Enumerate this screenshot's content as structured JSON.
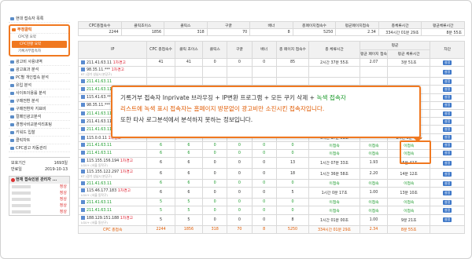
{
  "sidebar": {
    "top_item": "현대 접속자 목록",
    "group_title": "부정클릭",
    "subitems": [
      "CPC별 요약",
      "CPC현황 요약",
      "기록거부접속자"
    ],
    "items": [
      "광고비 사용내역",
      "광고효과 분석",
      "PC별 개인접속 분석",
      "유입 분석",
      "사이트이용률 분석",
      "구매전환 분석",
      "구매전환자 지표비",
      "컬페인광고분석",
      "경쟁사비교분석리포팅",
      "키워드 입찰",
      "클릭차트",
      "CPC광고 자동관리"
    ],
    "info": [
      {
        "label": "보호기간",
        "value": "1693일"
      },
      {
        "label": "만료일",
        "value": "2019-10-13"
      }
    ],
    "panel_title": "현재 접속인원 관리자 ...",
    "panel_rows": [
      "정상",
      "정상",
      "정상",
      "정상",
      "정상"
    ]
  },
  "summary": {
    "headers": [
      "CPC총접속수",
      "클릭초이스",
      "클릭스",
      "구글",
      "배너",
      "총페이지접속수",
      "평균페이지접속",
      "총체류시간",
      "평균체류시간"
    ],
    "values": [
      "2244",
      "1856",
      "318",
      "70",
      "8",
      "5250",
      "2.34",
      "334시간 01분 29초",
      "8분 55초"
    ]
  },
  "detail": {
    "headers": [
      "IP",
      "CPC 총접속수",
      "클릭 초이스",
      "클릭스",
      "구글",
      "배너",
      "총 페이지 접속수",
      "총 체류시간",
      "평균 페이지 접속",
      "평균 체류시간",
      "차단"
    ],
    "group_header": "평균",
    "block_label": "설정",
    "rows": [
      {
        "ip": "211.41.63.11",
        "mark": "1차경고",
        "sub": "",
        "cpc": "41",
        "cc": "41",
        "cs": "0",
        "gg": "0",
        "bn": "0",
        "tp": "85",
        "tt": "2시간 37분 55초",
        "ap": "2.07",
        "at": "3분 51초",
        "green": false
      },
      {
        "ip": "98.35.11.***",
        "mark": "1차경고",
        "sub": "KT (경기 성남시 분당구)",
        "cpc": "",
        "cc": "",
        "cs": "",
        "gg": "",
        "bn": "",
        "tp": "",
        "tt": "",
        "ap": "",
        "at": "",
        "green": false
      },
      {
        "ip": "211.41.63.11",
        "mark": "",
        "sub": "",
        "cpc": "",
        "cc": "",
        "cs": "",
        "gg": "",
        "bn": "",
        "tp": "",
        "tt": "",
        "ap": "",
        "at": "",
        "green": true
      },
      {
        "ip": "211.41.63.11",
        "mark": "",
        "sub": "",
        "cpc": "",
        "cc": "",
        "cs": "",
        "gg": "",
        "bn": "",
        "tp": "",
        "tt": "",
        "ap": "",
        "at": "",
        "green": true
      },
      {
        "ip": "115.41.63.***",
        "mark": "",
        "sub": "",
        "cpc": "",
        "cc": "",
        "cs": "",
        "gg": "",
        "bn": "",
        "tp": "",
        "tt": "",
        "ap": "",
        "at": "",
        "green": false
      },
      {
        "ip": "98.35.11.***",
        "mark": "",
        "sub": "",
        "cpc": "",
        "cc": "",
        "cs": "",
        "gg": "",
        "bn": "",
        "tp": "",
        "tt": "",
        "ap": "",
        "at": "",
        "green": false
      },
      {
        "ip": "211.41.63.11",
        "mark": "",
        "sub": "",
        "cpc": "",
        "cc": "",
        "cs": "",
        "gg": "",
        "bn": "",
        "tp": "",
        "tt": "",
        "ap": "",
        "at": "",
        "green": true
      },
      {
        "ip": "211.41.63.11",
        "mark": "",
        "sub": "",
        "cpc": "",
        "cc": "",
        "cs": "",
        "gg": "",
        "bn": "",
        "tp": "",
        "tt": "",
        "ap": "",
        "at": "",
        "green": false
      },
      {
        "ip": "211.41.63.11",
        "mark": "",
        "sub": "",
        "cpc": "",
        "cc": "",
        "cs": "",
        "gg": "",
        "bn": "",
        "tp": "",
        "tt": "",
        "ap": "",
        "at": "",
        "green": true
      },
      {
        "ip": "115.0.0.11",
        "mark": "1차경고",
        "sub": "",
        "cpc": "9",
        "cc": "4",
        "cs": "5",
        "gg": "0",
        "bn": "0",
        "tp": "121",
        "tt": "9시간 17분 51초",
        "ap": "13.44",
        "at": "1시간 0분 43초",
        "green": false
      },
      {
        "ip": "211.41.63.11",
        "mark": "",
        "sub": "",
        "cpc": "6",
        "cc": "6",
        "cs": "0",
        "gg": "0",
        "bn": "0",
        "tp": "0",
        "tt": "이접속",
        "ap": "이접속",
        "at": "이접속",
        "green": true
      },
      {
        "ip": "211.41.63.11",
        "mark": "",
        "sub": "",
        "cpc": "6",
        "cc": "6",
        "cs": "0",
        "gg": "0",
        "bn": "0",
        "tp": "0",
        "tt": "이접속",
        "ap": "이접속",
        "at": "이접속",
        "green": true
      },
      {
        "ip": "115.155.156.194",
        "mark": "1차경고",
        "sub": "LGU+ (서울 동작구)",
        "cpc": "6",
        "cc": "6",
        "cs": "0",
        "gg": "0",
        "bn": "0",
        "tp": "13",
        "tt": "1시간 07분 33초",
        "ap": "1.93",
        "at": "15분 42초",
        "green": false
      },
      {
        "ip": "115.155.122.297",
        "mark": "1차경고",
        "sub": "KT (경기 성남시 분당구)",
        "cpc": "6",
        "cc": "6",
        "cs": "0",
        "gg": "0",
        "bn": "0",
        "tp": "18",
        "tt": "1시간 36분 58초",
        "ap": "2.20",
        "at": "14분 12초",
        "green": false
      },
      {
        "ip": "211.41.63.11",
        "mark": "",
        "sub": "",
        "cpc": "6",
        "cc": "6",
        "cs": "0",
        "gg": "0",
        "bn": "0",
        "tp": "0",
        "tt": "이접속",
        "ap": "이접속",
        "at": "이접속",
        "green": true
      },
      {
        "ip": "115.46.177.183",
        "mark": "1차경고",
        "sub": "LGU+ (서울 동작구)",
        "cpc": "6",
        "cc": "6",
        "cs": "0",
        "gg": "0",
        "bn": "0",
        "tp": "5",
        "tt": "1시간 0분 17초",
        "ap": "1.00",
        "at": "13분 10초",
        "green": false
      },
      {
        "ip": "211.41.63.11",
        "mark": "",
        "sub": "",
        "cpc": "5",
        "cc": "5",
        "cs": "0",
        "gg": "0",
        "bn": "0",
        "tp": "0",
        "tt": "이접속",
        "ap": "이접속",
        "at": "이접속",
        "green": true
      },
      {
        "ip": "211.41.63.11",
        "mark": "",
        "sub": "",
        "cpc": "5",
        "cc": "5",
        "cs": "0",
        "gg": "0",
        "bn": "0",
        "tp": "0",
        "tt": "이접속",
        "ap": "이접속",
        "at": "이접속",
        "green": true
      },
      {
        "ip": "188.129.151.188",
        "mark": "1차경고",
        "sub": "LGU+ (서울 동산구)",
        "cpc": "5",
        "cc": "5",
        "cs": "0",
        "gg": "0",
        "bn": "0",
        "tp": "8",
        "tt": "1시간 01분 00초",
        "ap": "1.00",
        "at": "9분 21초",
        "green": false
      }
    ],
    "total": {
      "label": "CPC 총접속",
      "cpc": "2244",
      "cc": "1856",
      "cs": "318",
      "gg": "70",
      "bn": "8",
      "tp": "5250",
      "tt": "334시간 01분 29초",
      "ap": "2.34",
      "at": "8분 55초"
    }
  },
  "callout": {
    "line1_a": "기록거부 접속자 Inprivate 브라우징 + IP변환 프로그램 + 모든 쿠키 삭제 + ",
    "line1_b": "녹색 접속자",
    "line2": "리스트에 녹색 표시 접속자는 홈페이지 방문없이 광고비만 소진시킨 접속자입니다.",
    "line3": "또한 타사 로그분석에서 분석하지 못하는 정보입니다."
  },
  "colors": {
    "accent": "#f07820",
    "green": "#1a9a2a",
    "warn": "#d23333",
    "button": "#3d77c8"
  }
}
